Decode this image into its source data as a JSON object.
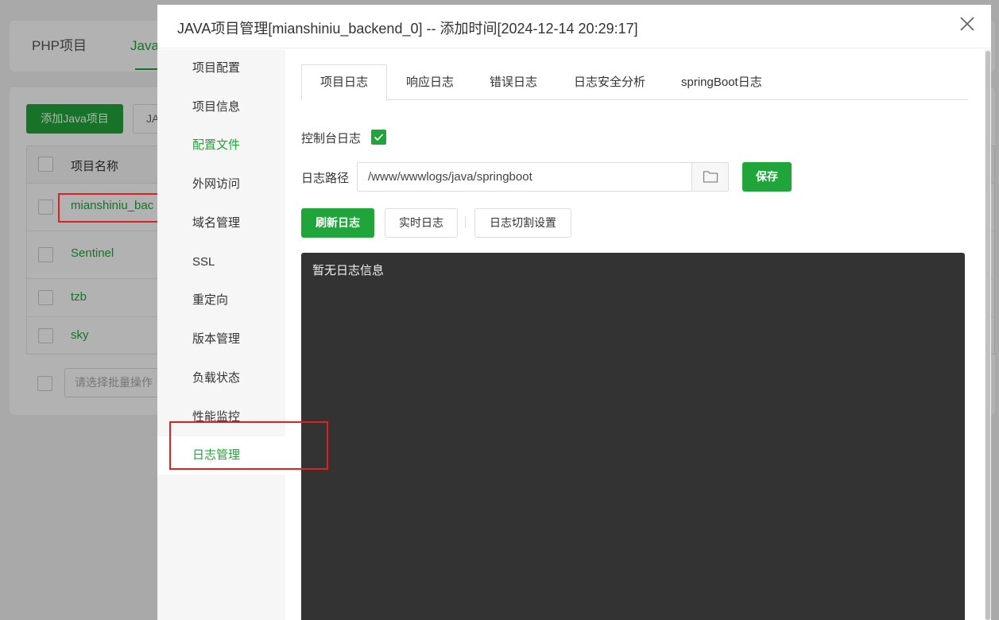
{
  "background": {
    "tabs": [
      "PHP项目",
      "Java"
    ],
    "add_button": "添加Java项目",
    "select_partial": "JA",
    "table_header": "项目名称",
    "rows": [
      "mianshiniu_bac",
      "Sentinel",
      "tzb",
      "sky"
    ],
    "batch_placeholder": "请选择批量操作"
  },
  "dialog": {
    "title": "JAVA项目管理[mianshiniu_backend_0] -- 添加时间[2024-12-14 20:29:17]",
    "sidebar": [
      {
        "label": "项目配置"
      },
      {
        "label": "项目信息"
      },
      {
        "label": "配置文件"
      },
      {
        "label": "外网访问"
      },
      {
        "label": "域名管理"
      },
      {
        "label": "SSL"
      },
      {
        "label": "重定向"
      },
      {
        "label": "版本管理"
      },
      {
        "label": "负载状态"
      },
      {
        "label": "性能监控"
      },
      {
        "label": "日志管理"
      }
    ],
    "tabs": [
      "项目日志",
      "响应日志",
      "错误日志",
      "日志安全分析",
      "springBoot日志"
    ],
    "console_log_label": "控制台日志",
    "console_log_checked": true,
    "log_path_label": "日志路径",
    "log_path_value": "/www/wwwlogs/java/springboot",
    "save_button": "保存",
    "refresh_button": "刷新日志",
    "realtime_button": "实时日志",
    "split_button": "日志切割设置",
    "log_empty": "暂无日志信息"
  },
  "colors": {
    "accent": "#20a53a",
    "log_bg": "#333333",
    "highlight": "#e02020"
  }
}
